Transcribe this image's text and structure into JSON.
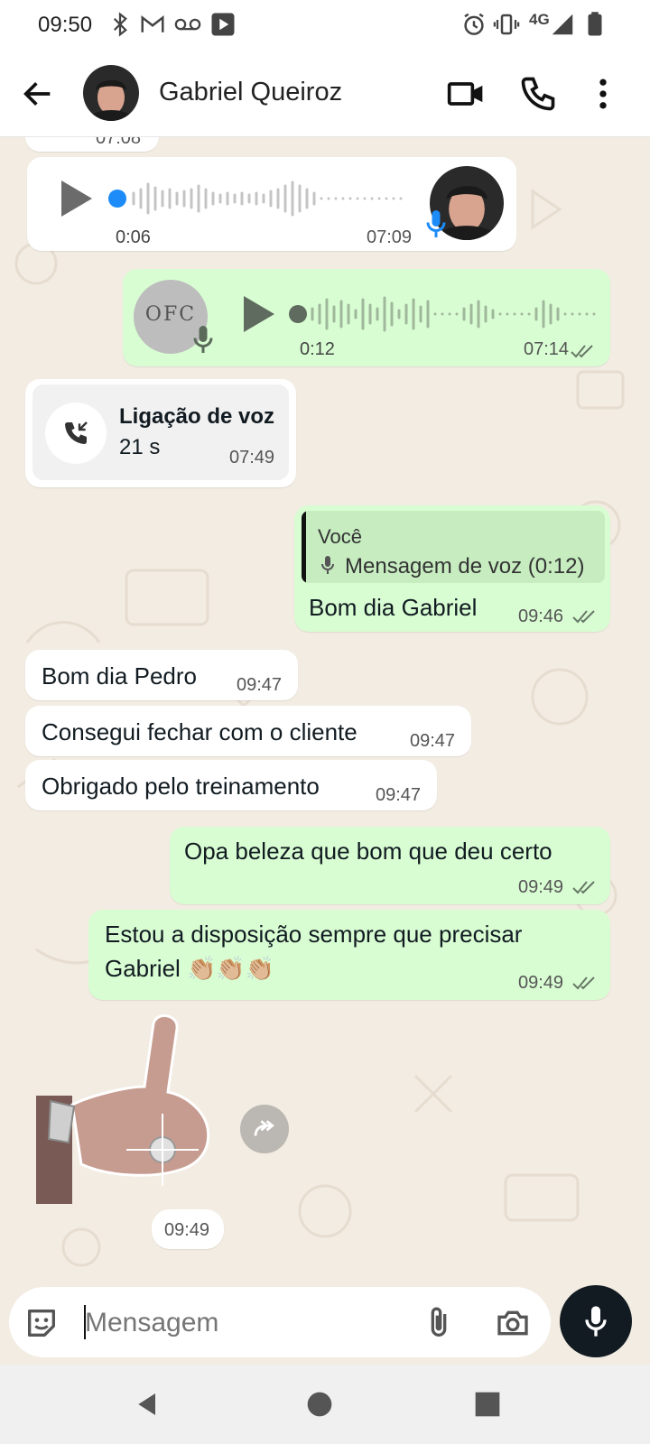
{
  "status_bar": {
    "time": "09:50",
    "left_icons": [
      "bluetooth-icon",
      "gmail-icon",
      "voicemail-icon",
      "play-store-icon"
    ],
    "right_icons": [
      "alarm-icon",
      "vibrate-icon",
      "signal-icon",
      "battery-icon"
    ],
    "network_label": "4G"
  },
  "header": {
    "contact_name": "Gabriel Queiroz",
    "actions": [
      "video-call-icon",
      "phone-icon",
      "more-options-icon"
    ]
  },
  "messages": {
    "prev_time": "07:08",
    "voice_in": {
      "duration": "0:06",
      "time": "07:09"
    },
    "voice_out": {
      "avatar_text": "OFC",
      "duration": "0:12",
      "time": "07:14"
    },
    "call": {
      "title": "Ligação de voz",
      "duration": "21 s",
      "time": "07:49"
    },
    "reply": {
      "quote_author": "Você",
      "quote_text": "Mensagem de voz (0:12)",
      "text": "Bom dia Gabriel",
      "time": "09:46"
    },
    "in1": {
      "text": "Bom dia Pedro",
      "time": "09:47"
    },
    "in2": {
      "text": "Consegui fechar com o cliente",
      "time": "09:47"
    },
    "in3": {
      "text": "Obrigado pelo treinamento",
      "time": "09:47"
    },
    "out1": {
      "text": "Opa beleza que bom que deu certo",
      "time": "09:49"
    },
    "out2": {
      "line1": "Estou a disposição sempre que precisar",
      "line2": "Gabriel 👏🏼👏🏼👏🏼",
      "time": "09:49"
    },
    "sticker": {
      "time": "09:49"
    }
  },
  "composer": {
    "placeholder": "Mensagem"
  },
  "colors": {
    "chat_bg": "#f2ece2",
    "outgoing_bubble": "#d9fdd3",
    "incoming_bubble": "#ffffff",
    "accent_blue": "#1d8cf8",
    "mic_button": "#111b21"
  }
}
